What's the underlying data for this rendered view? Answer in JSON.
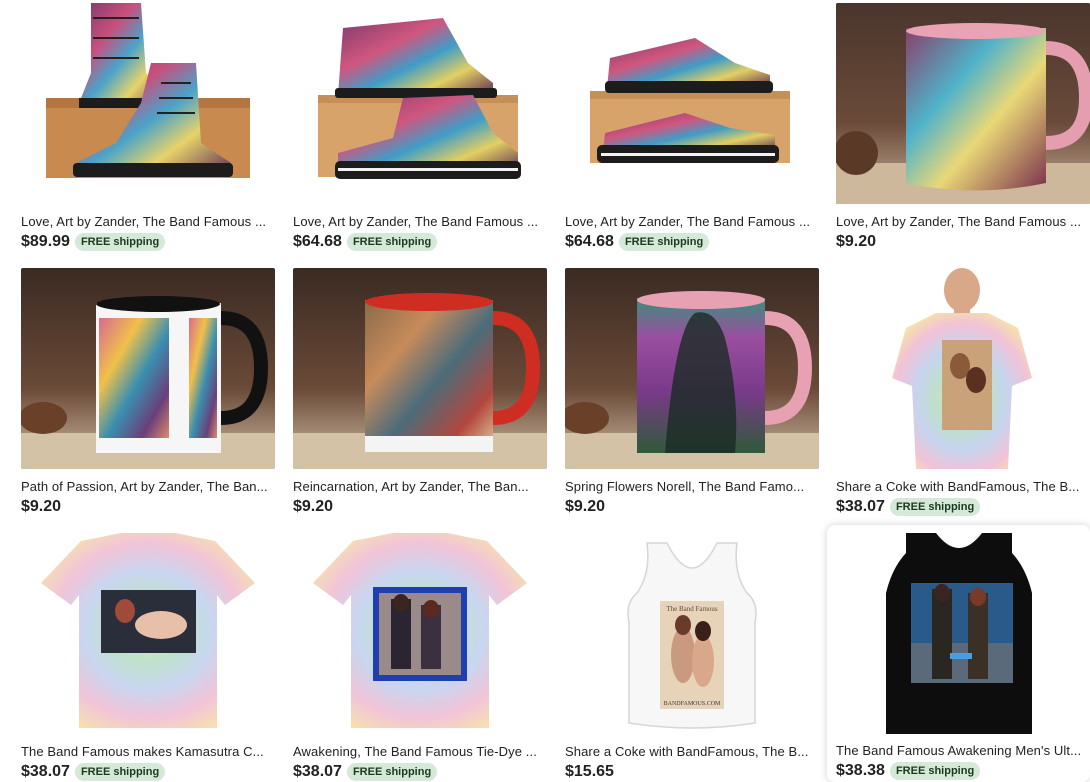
{
  "listings": [
    {
      "title": "Love, Art by Zander, The Band Famous ...",
      "price": "$89.99",
      "badge": "FREE shipping",
      "image": "combat-boots"
    },
    {
      "title": "Love, Art by Zander, The Band Famous ...",
      "price": "$64.68",
      "badge": "FREE shipping",
      "image": "high-top-sneakers"
    },
    {
      "title": "Love, Art by Zander, The Band Famous ...",
      "price": "$64.68",
      "badge": "FREE shipping",
      "image": "low-top-sneakers"
    },
    {
      "title": "Love, Art by Zander, The Band Famous ...",
      "price": "$9.20",
      "badge": "",
      "image": "pink-mug"
    },
    {
      "title": "Path of Passion, Art by Zander, The Ban...",
      "price": "$9.20",
      "badge": "",
      "image": "black-handle-mug"
    },
    {
      "title": "Reincarnation, Art by Zander, The Ban...",
      "price": "$9.20",
      "badge": "",
      "image": "red-handle-mug"
    },
    {
      "title": "Spring Flowers Norell, The Band Famo...",
      "price": "$9.20",
      "badge": "",
      "image": "pink-handle-mug"
    },
    {
      "title": "Share a Coke with BandFamous, The B...",
      "price": "$38.07",
      "badge": "FREE shipping",
      "image": "tie-dye-tee-model"
    },
    {
      "title": "The Band Famous makes Kamasutra C...",
      "price": "$38.07",
      "badge": "FREE shipping",
      "image": "tie-dye-tee"
    },
    {
      "title": "Awakening, The Band Famous Tie-Dye ...",
      "price": "$38.07",
      "badge": "FREE shipping",
      "image": "tie-dye-tee-blue-frame"
    },
    {
      "title": "Share a Coke with BandFamous, The B...",
      "price": "$15.65",
      "badge": "",
      "image": "white-tank-top"
    },
    {
      "title": "The Band Famous Awakening Men's Ult...",
      "price": "$38.38",
      "badge": "FREE shipping",
      "image": "black-tank-top"
    }
  ],
  "print_text": {
    "tank_header": "The Band Famous",
    "tank_footer": "BANDFAMOUS.COM"
  },
  "colors": {
    "free_shipping_bg": "#d4e9d7",
    "free_shipping_text": "#1b3a1f"
  }
}
